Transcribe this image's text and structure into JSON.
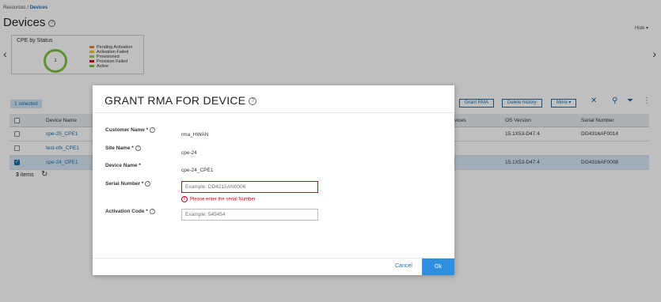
{
  "breadcrumb": {
    "parent": "Resources",
    "separator": "/",
    "current": "Devices"
  },
  "page": {
    "title": "Devices",
    "hide_label": "Hide"
  },
  "widget": {
    "title": "CPE by Status",
    "donut_value": "1",
    "legend": [
      {
        "label": "Pending Activation",
        "color": "#e8852b"
      },
      {
        "label": "Activation Failed",
        "color": "#f2c12e"
      },
      {
        "label": "Provisioned",
        "color": "#a0c854"
      },
      {
        "label": "Provision Failed",
        "color": "#d0021b"
      },
      {
        "label": "Active",
        "color": "#7bc142"
      }
    ]
  },
  "toolbar": {
    "selected_label": "1 selected",
    "grant_rma_label": "Grant RMA",
    "delete_history_label": "Delete history",
    "more_label": "More"
  },
  "grid": {
    "columns": {
      "device_name": "Device Name",
      "vices": "vices",
      "os_version": "OS Version",
      "serial_number": "Serial Number"
    },
    "rows": [
      {
        "name": "cpe-25_CPE1",
        "os": "15.1X53-D47.4",
        "serial": "DG4316AF0014",
        "checked": false
      },
      {
        "name": "test-nfx_CPE1",
        "os": "",
        "serial": "",
        "checked": false
      },
      {
        "name": "cpe-24_CPE1",
        "os": "15.1X53-D47.4",
        "serial": "DG4316AF0008",
        "checked": true
      }
    ],
    "items_count": "3",
    "items_label": "items"
  },
  "modal": {
    "title": "GRANT RMA FOR DEVICE",
    "customer_name_label": "Customer Name *",
    "customer_name_value": "rma_HWAN",
    "site_name_label": "Site Name *",
    "site_name_value": "cpe-24",
    "device_name_label": "Device Name *",
    "device_name_value": "cpe-24_CPE1",
    "serial_number_label": "Serial Number *",
    "serial_number_placeholder": "Example: DD4215AN0006",
    "serial_number_error": "Please enter the serial Number",
    "activation_code_label": "Activation Code *",
    "activation_code_placeholder": "Example: 545454",
    "cancel_label": "Cancel",
    "ok_label": "Ok"
  },
  "colors": {
    "accent": "#1c6ca8",
    "ok_button": "#2e8fe0",
    "error": "#d0021b",
    "donut": "#7bc142"
  }
}
